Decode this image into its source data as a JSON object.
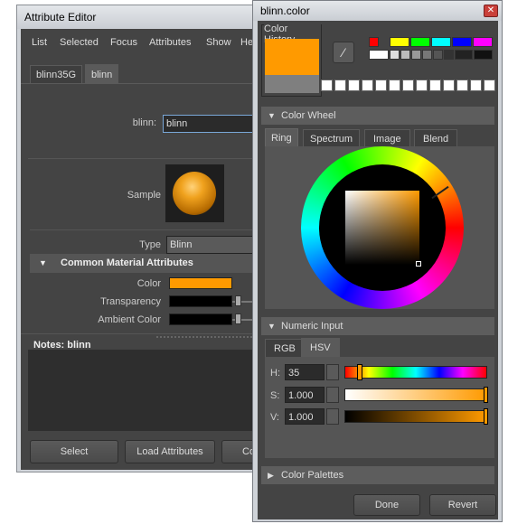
{
  "attribute_editor": {
    "title": "Attribute Editor",
    "menu": [
      "List",
      "Selected",
      "Focus",
      "Attributes",
      "Show",
      "He"
    ],
    "tabs": [
      "blinn35G",
      "blinn"
    ],
    "node_label": "blinn:",
    "node_value": "blinn",
    "sample_label": "Sample",
    "type_label": "Type",
    "type_value": "Blinn",
    "section_common": "Common Material Attributes",
    "color_label": "Color",
    "transparency_label": "Transparency",
    "ambient_label": "Ambient Color",
    "notes_label": "Notes:  blinn",
    "buttons": {
      "select": "Select",
      "load": "Load Attributes",
      "copy": "Co"
    },
    "colors": {
      "color": "#ff9a00",
      "transparency": "#000000",
      "ambient": "#000000"
    }
  },
  "color_window": {
    "title": "blinn.color",
    "close_icon": "close-icon",
    "history_label": "Color History",
    "current_color": "#ff9a00",
    "previous_color": "#7f7f7f",
    "swatches": [
      "#ff0000",
      "#ffff00",
      "#00ff00",
      "#00ffff",
      "#0000ff",
      "#ff00ff",
      "#ffffff",
      "#dddddd",
      "#bbbbbb",
      "#999999",
      "#777777",
      "#555555",
      "#333333",
      "#111111"
    ],
    "color_wheel_label": "Color Wheel",
    "wheel_tabs": [
      "Ring",
      "Spectrum",
      "Image",
      "Blend"
    ],
    "numeric_label": "Numeric Input",
    "input_tabs": [
      "RGB",
      "HSV"
    ],
    "h_label": "H:",
    "h_value": "35",
    "s_label": "S:",
    "s_value": "1.000",
    "v_label": "V:",
    "v_value": "1.000",
    "palettes_label": "Color Palettes",
    "done_label": "Done",
    "revert_label": "Revert"
  }
}
